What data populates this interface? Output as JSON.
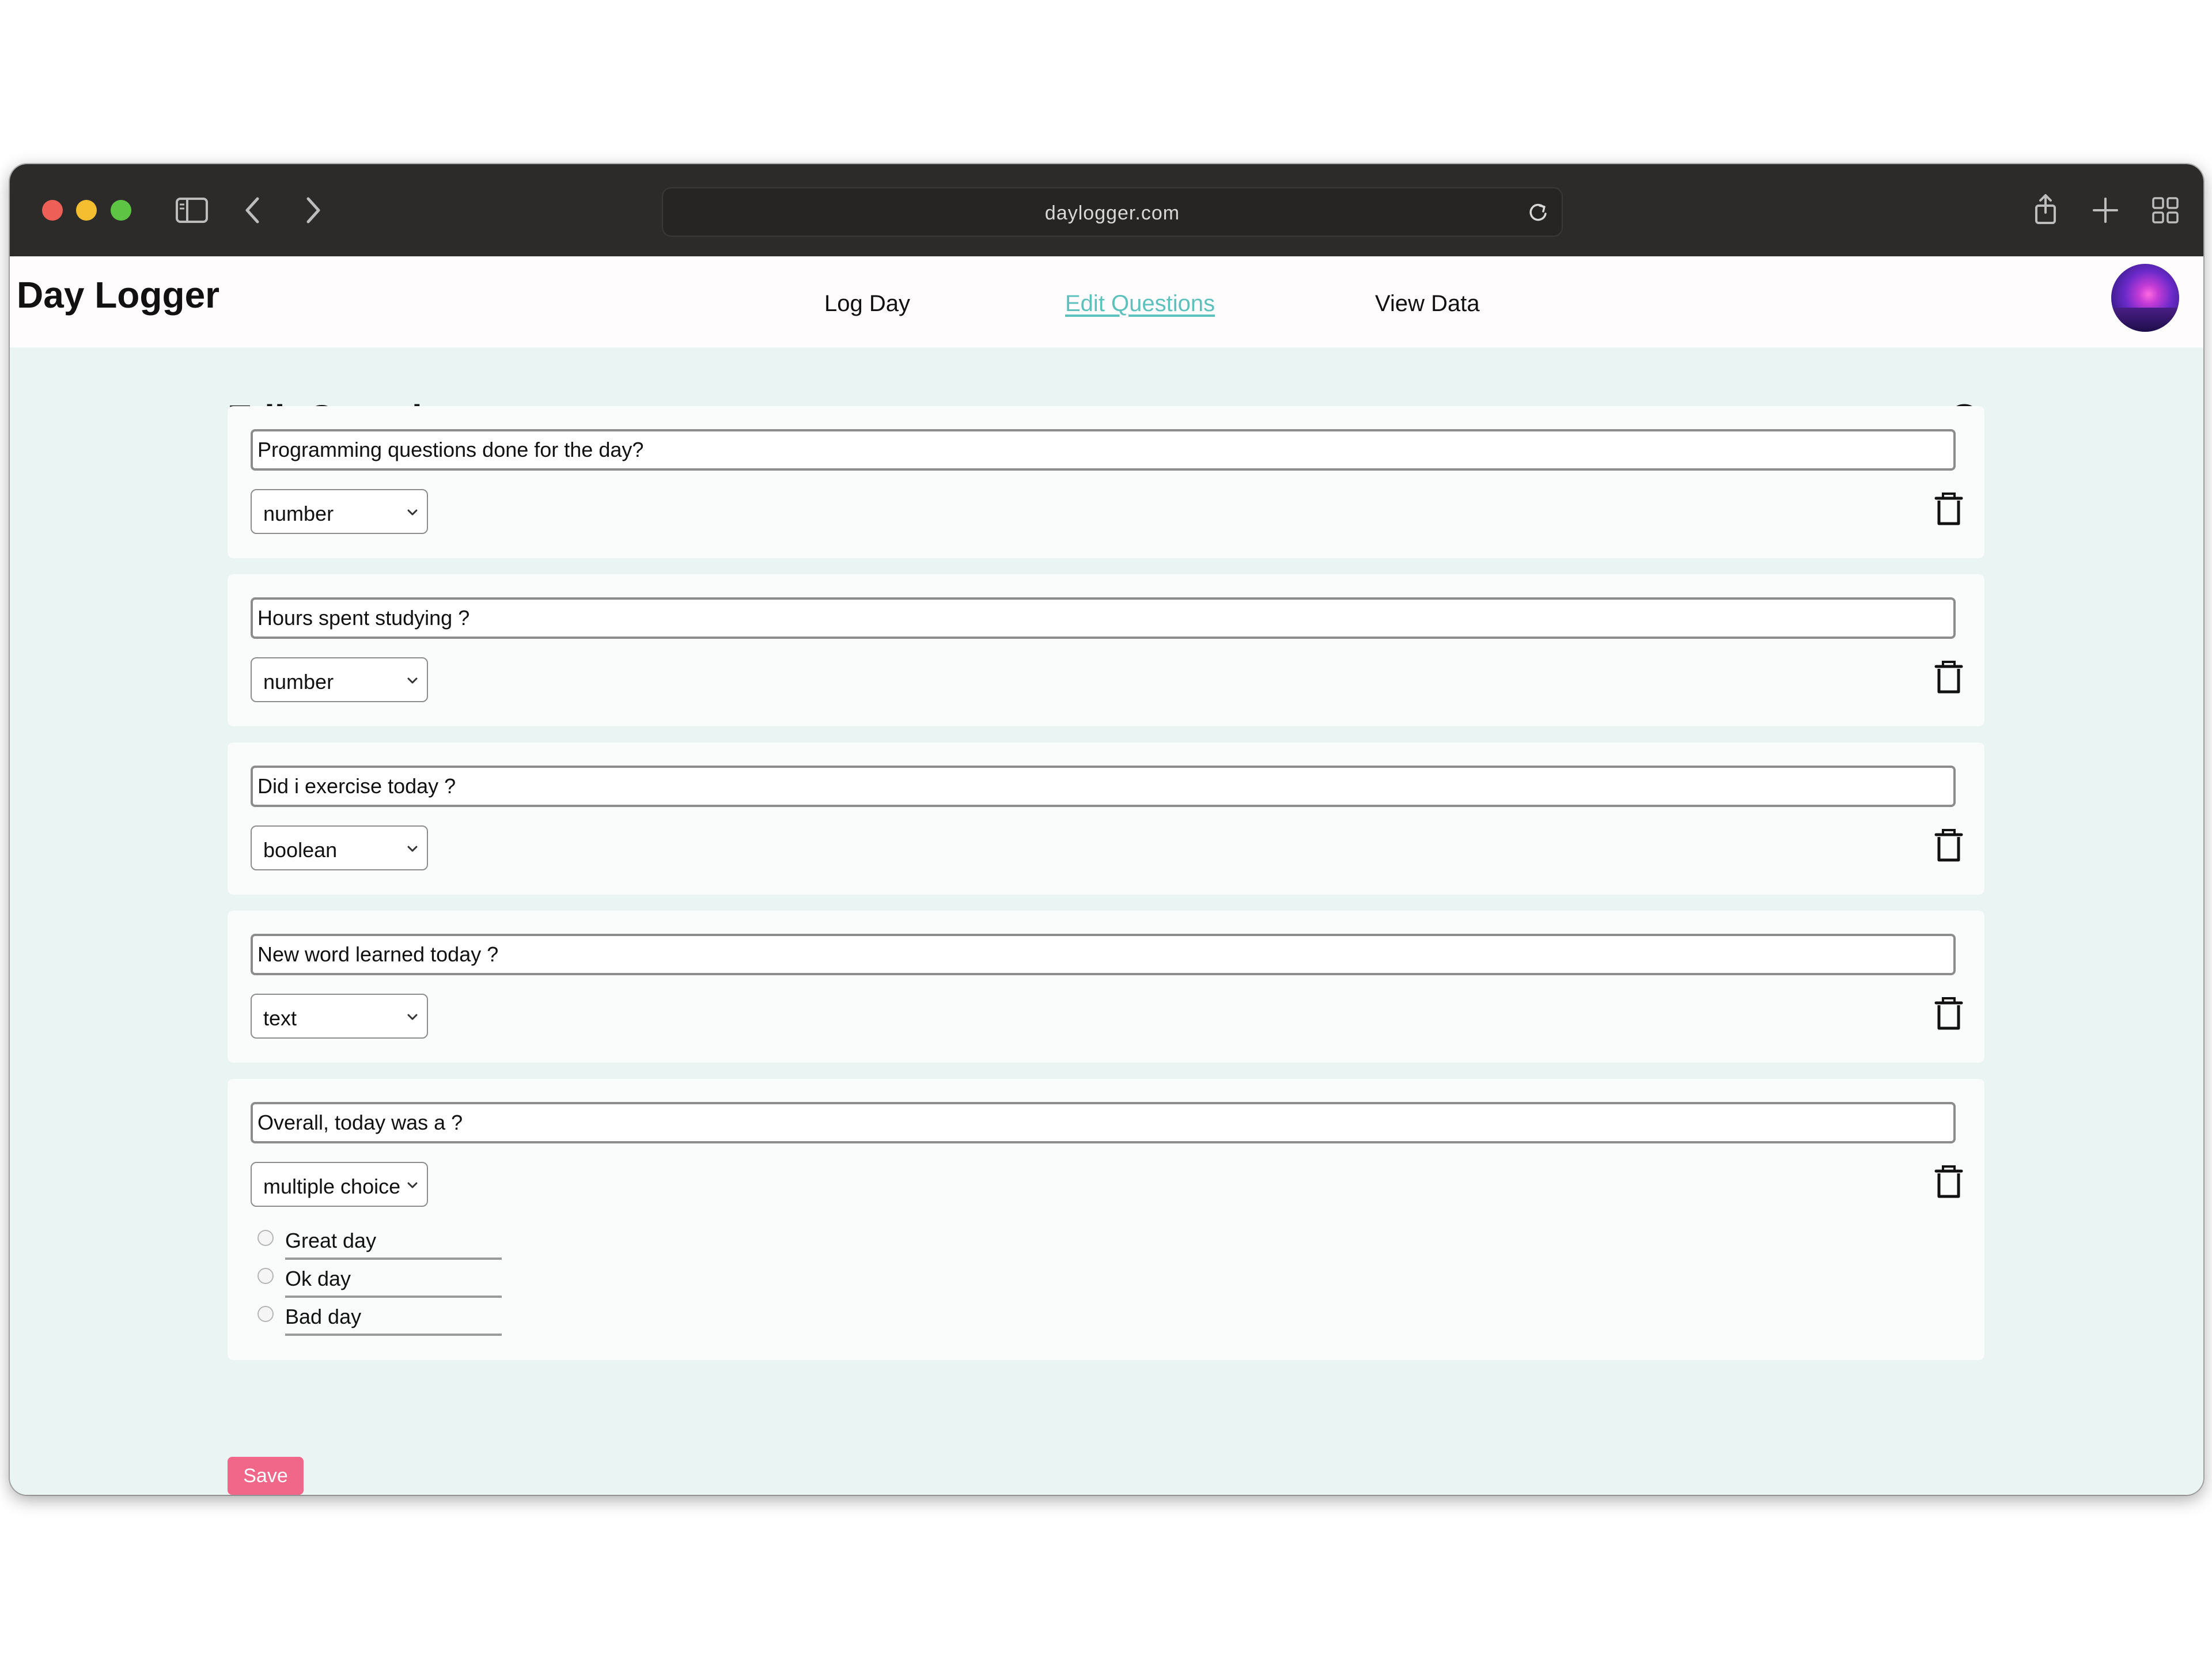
{
  "browser": {
    "url": "daylogger.com"
  },
  "app": {
    "brand": "Day Logger",
    "nav": [
      {
        "label": "Log Day",
        "active": false
      },
      {
        "label": "Edit Questions",
        "active": true
      },
      {
        "label": "View Data",
        "active": false
      }
    ]
  },
  "page": {
    "title": "Edit Questions",
    "questions": [
      {
        "text": "Programming questions done for the day?",
        "type": "number"
      },
      {
        "text": "Hours spent studying ?",
        "type": "number"
      },
      {
        "text": "Did i exercise today ?",
        "type": "boolean"
      },
      {
        "text": "New word learned today ?",
        "type": "text"
      },
      {
        "text": "Overall, today was a ?",
        "type": "multiple choice",
        "options": [
          "Great day",
          "Ok day",
          "Bad day"
        ]
      }
    ],
    "save_label": "Save"
  },
  "colors": {
    "accent": "#5cc1bd",
    "save": "#f0678a",
    "background": "#eaf4f3"
  }
}
